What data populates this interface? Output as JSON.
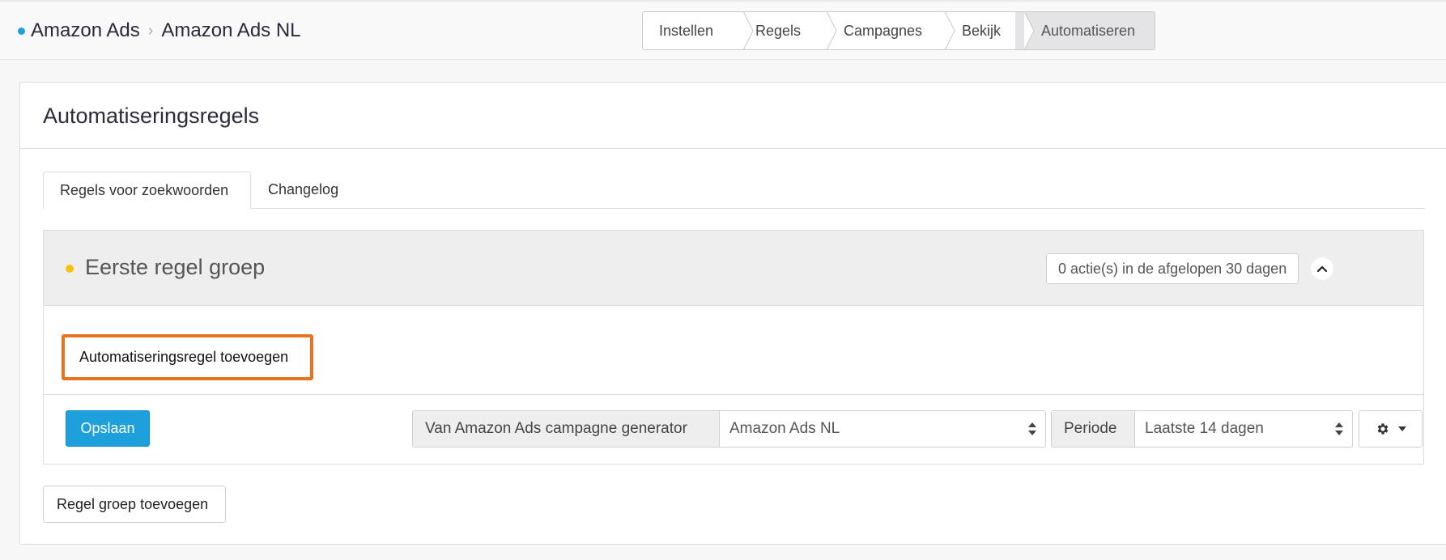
{
  "breadcrumb": {
    "root": "Amazon Ads",
    "current": "Amazon Ads NL"
  },
  "steps": [
    "Instellen",
    "Regels",
    "Campagnes",
    "Bekijk",
    "Automatiseren"
  ],
  "steps_active": "Automatiseren",
  "panel": {
    "title": "Automatiseringsregels"
  },
  "tabs": [
    {
      "label": "Regels voor zoekwoorden",
      "active": true
    },
    {
      "label": "Changelog",
      "active": false
    }
  ],
  "rule_group": {
    "title": "Eerste regel groep",
    "status_color": "#f4c20d",
    "actions_badge": "0 actie(s) in de afgelopen 30 dagen",
    "add_rule_label": "Automatiseringsregel toevoegen",
    "add_rule_highlight_color": "#e8731e"
  },
  "footer": {
    "save_label": "Opslaan",
    "source_label": "Van Amazon Ads campagne generator",
    "source_value": "Amazon Ads NL",
    "period_label": "Periode",
    "period_value": "Laatste 14 dagen",
    "settings_icon": "gear-icon"
  },
  "add_group_label": "Regel groep toevoegen",
  "colors": {
    "accent": "#1ea0dc",
    "breadcrumb_dot": "#1ea0dc"
  }
}
